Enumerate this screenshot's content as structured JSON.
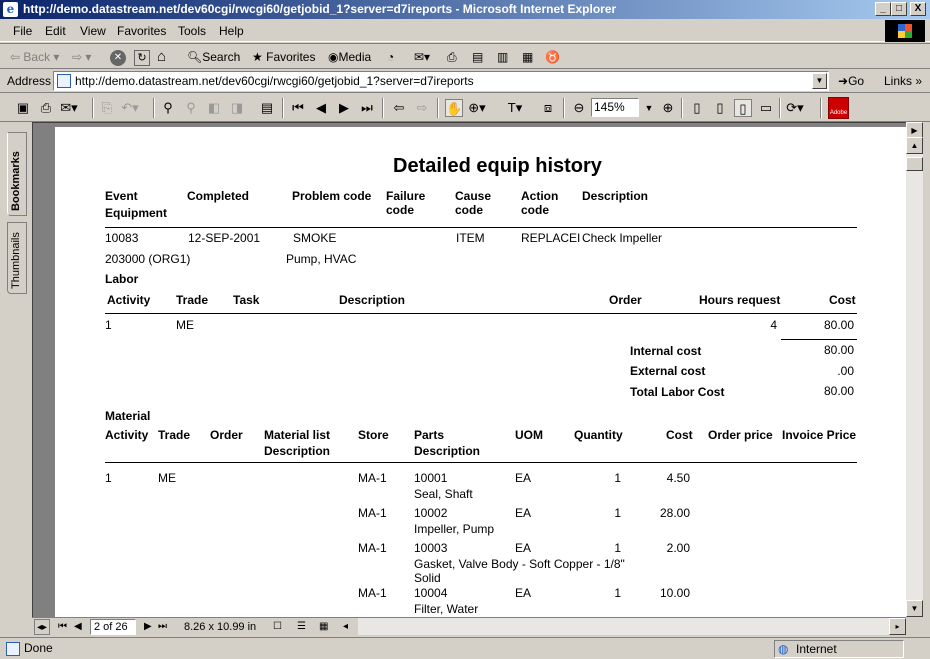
{
  "window": {
    "title": "http://demo.datastream.net/dev60cgi/rwcgi60/getjobid_1?server=d7ireports - Microsoft Internet Explorer",
    "controls": [
      "_",
      "□",
      "X"
    ]
  },
  "menu": [
    "File",
    "Edit",
    "View",
    "Favorites",
    "Tools",
    "Help"
  ],
  "toolbar": {
    "back": "Back",
    "search": "Search",
    "favorites": "Favorites",
    "media": "Media"
  },
  "address": {
    "label": "Address",
    "url": "http://demo.datastream.net/dev60cgi/rwcgi60/getjobid_1?server=d7ireports",
    "go": "Go",
    "links": "Links"
  },
  "acrobat": {
    "zoom": "145%",
    "logo_text": "Adobe"
  },
  "sidetabs": {
    "bookmarks": "Bookmarks",
    "thumbnails": "Thumbnails"
  },
  "report": {
    "title": "Detailed equip history",
    "header": {
      "event": "Event",
      "equipment": "Equipment",
      "completed": "Completed",
      "problem_code": "Problem code",
      "failure_code_1": "Failure",
      "failure_code_2": "code",
      "cause_code_1": "Cause",
      "cause_code_2": "code",
      "action_code_1": "Action",
      "action_code_2": "code",
      "description": "Description"
    },
    "event": {
      "event": "10083",
      "completed": "12-SEP-2001",
      "problem_code": "SMOKE",
      "cause_code": "ITEM",
      "action_code": "REPLACEI",
      "description": "Check Impeller",
      "equipment": "203000 (ORG1)",
      "equipment_desc": "Pump, HVAC"
    },
    "labor": {
      "section": "Labor",
      "headers": {
        "activity": "Activity",
        "trade": "Trade",
        "task": "Task",
        "description": "Description",
        "order": "Order",
        "hours": "Hours request",
        "cost": "Cost"
      },
      "row": {
        "activity": "1",
        "trade": "ME",
        "hours": "4",
        "cost": "80.00"
      },
      "internal_cost_label": "Internal cost",
      "internal_cost": "80.00",
      "external_cost_label": "External cost",
      "external_cost": ".00",
      "total_label": "Total Labor Cost",
      "total": "80.00"
    },
    "material": {
      "section": "Material",
      "headers": {
        "activity": "Activity",
        "trade": "Trade",
        "order": "Order",
        "material_list_1": "Material list",
        "material_list_2": "Description",
        "store": "Store",
        "parts_1": "Parts",
        "parts_2": "Description",
        "uom": "UOM",
        "quantity": "Quantity",
        "cost": "Cost",
        "order_price": "Order price",
        "invoice_price": "Invoice Price"
      },
      "activity": "1",
      "trade": "ME",
      "rows": [
        {
          "store": "MA-1",
          "part": "10001",
          "desc1": "Seal, Shaft",
          "desc2": "",
          "uom": "EA",
          "qty": "1",
          "cost": "4.50"
        },
        {
          "store": "MA-1",
          "part": "10002",
          "desc1": "Impeller, Pump",
          "desc2": "",
          "uom": "EA",
          "qty": "1",
          "cost": "28.00"
        },
        {
          "store": "MA-1",
          "part": "10003",
          "desc1": "Gasket, Valve Body - Soft Copper - 1/8\"",
          "desc2": "Solid",
          "uom": "EA",
          "qty": "1",
          "cost": "2.00"
        },
        {
          "store": "MA-1",
          "part": "10004",
          "desc1": "Filter, Water",
          "desc2": "",
          "uom": "EA",
          "qty": "1",
          "cost": "10.00"
        }
      ]
    }
  },
  "navbar": {
    "page": "2 of 26",
    "size": "8.26 x 10.99 in"
  },
  "status": {
    "text": "Done",
    "zone": "Internet"
  }
}
